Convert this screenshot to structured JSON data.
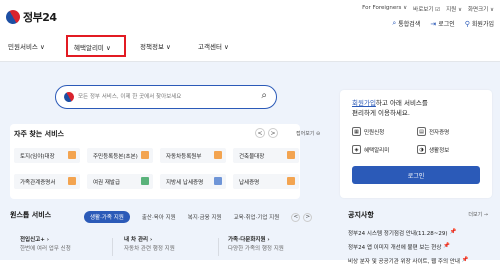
{
  "header": {
    "logo_text": "정부24",
    "util": [
      "For Foreigners ∨",
      "바로보기 ☑",
      "지원 ∨",
      "화면크기 ∨"
    ],
    "member": [
      {
        "icon": "⌕",
        "label": "통합검색"
      },
      {
        "icon": "⇥",
        "label": "로그인"
      },
      {
        "icon": "⚲",
        "label": "회원가입"
      }
    ]
  },
  "nav": {
    "items": [
      "민원서비스 ∨",
      "혜택알리미 ∨",
      "정책정보 ∨",
      "고객센터 ∨"
    ]
  },
  "search": {
    "placeholder": "모든 정부 서비스, 이제 한 곳에서 찾아보세요"
  },
  "login": {
    "link": "회원가입",
    "msg_line1_rest": "하고 아래 서비스를",
    "msg_line2": "편리하게 이용하세요.",
    "links": [
      {
        "icon": "▦",
        "label": "민원신청"
      },
      {
        "icon": "▤",
        "label": "전자증명"
      },
      {
        "icon": "◈",
        "label": "혜택알리미"
      },
      {
        "icon": "◑",
        "label": "생활정보"
      }
    ],
    "button": "로그인"
  },
  "frequent": {
    "title": "자주 찾는 서비스",
    "prev": "<",
    "next": ">",
    "more": "접어보기 ⊖",
    "items": [
      "토지(임야)대장",
      "주민등록등본(초본)",
      "자동차등록원부",
      "건축물대장",
      "가족관계증명서",
      "여권 재발급",
      "지방세 납세증명",
      "납세증명"
    ]
  },
  "onestop": {
    "title": "원스톱 서비스",
    "tabs": [
      "생활·가족 지원",
      "출산·육아 지원",
      "복지·금융 지원",
      "교육·취업·기업 지원"
    ],
    "prev": "<",
    "next": ">",
    "items": [
      {
        "title": "전입신고+ ›",
        "desc": "한번에 여러 업무 신청"
      },
      {
        "title": "내 차 관리 ›",
        "desc": "자동차 관련 행정 지원"
      },
      {
        "title": "가족·다문화지원 ›",
        "desc": "다양한 가족의 행정 지원"
      }
    ]
  },
  "notice": {
    "title": "공지사항",
    "more": "더보기 →",
    "items": [
      "정부24 시스템 정기점검 안내(11.28~29)",
      "정부24 앱 이미지 개선에 불편 보는 현상",
      "비상 분자 및 공공기관 위장 사이트, 웹 주의 안내"
    ]
  }
}
